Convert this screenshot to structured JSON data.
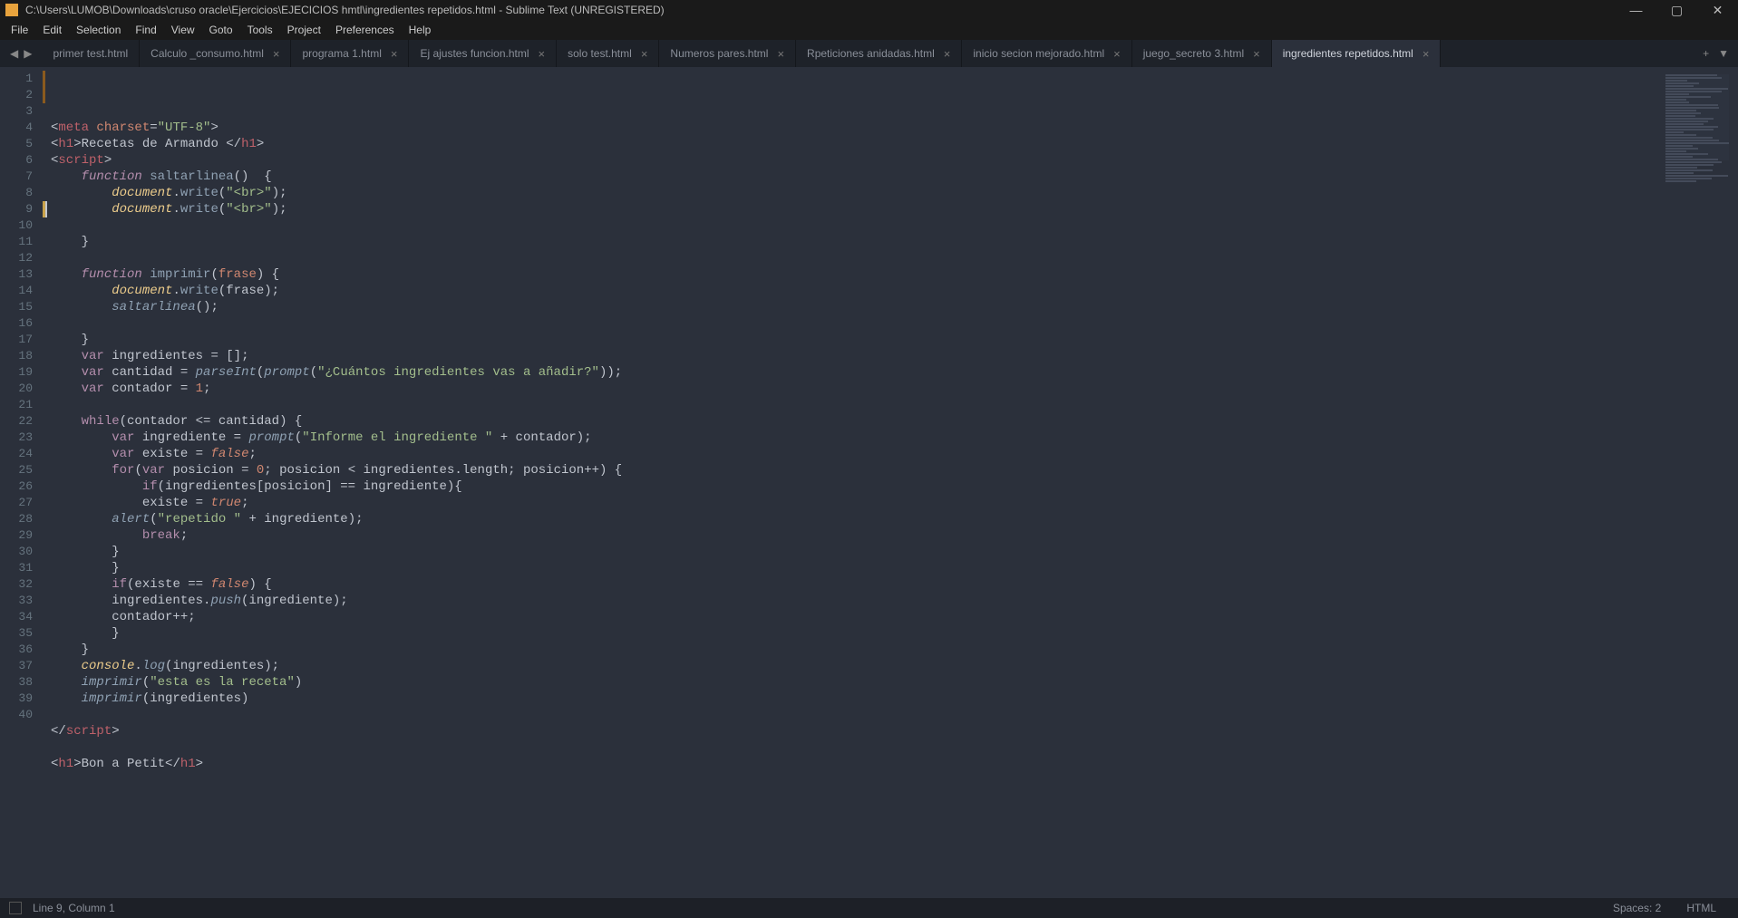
{
  "window": {
    "title": "C:\\Users\\LUMOB\\Downloads\\cruso oracle\\Ejercicios\\EJECICIOS hmtl\\ingredientes repetidos.html - Sublime Text (UNREGISTERED)"
  },
  "menu": [
    "File",
    "Edit",
    "Selection",
    "Find",
    "View",
    "Goto",
    "Tools",
    "Project",
    "Preferences",
    "Help"
  ],
  "tabs": [
    {
      "label": "primer test.html",
      "active": false,
      "closable": false
    },
    {
      "label": "Calculo _consumo.html",
      "active": false,
      "closable": true
    },
    {
      "label": "programa 1.html",
      "active": false,
      "closable": true
    },
    {
      "label": "Ej ajustes funcion.html",
      "active": false,
      "closable": true
    },
    {
      "label": "solo test.html",
      "active": false,
      "closable": true
    },
    {
      "label": "Numeros pares.html",
      "active": false,
      "closable": true
    },
    {
      "label": "Rpeticiones anidadas.html",
      "active": false,
      "closable": true
    },
    {
      "label": "inicio secion mejorado.html",
      "active": false,
      "closable": true
    },
    {
      "label": "juego_secreto 3.html",
      "active": false,
      "closable": true
    },
    {
      "label": "ingredientes repetidos.html",
      "active": true,
      "closable": true
    }
  ],
  "code_lines": [
    [
      [
        "<",
        "c-punct"
      ],
      [
        "meta",
        "c-tag"
      ],
      [
        " ",
        "c-punct"
      ],
      [
        "charset",
        "c-attr"
      ],
      [
        "=",
        "c-op"
      ],
      [
        "\"UTF-8\"",
        "c-str"
      ],
      [
        ">",
        "c-punct"
      ]
    ],
    [
      [
        "<",
        "c-punct"
      ],
      [
        "h1",
        "c-tag"
      ],
      [
        ">",
        "c-punct"
      ],
      [
        "Recetas de Armando ",
        "c-var"
      ],
      [
        "</",
        "c-punct"
      ],
      [
        "h1",
        "c-tag"
      ],
      [
        ">",
        "c-punct"
      ]
    ],
    [
      [
        "<",
        "c-punct"
      ],
      [
        "script",
        "c-tag"
      ],
      [
        ">",
        "c-punct"
      ]
    ],
    [
      [
        "    ",
        "c-var"
      ],
      [
        "function",
        "c-kwst"
      ],
      [
        " ",
        "c-var"
      ],
      [
        "saltarlinea",
        "c-fn"
      ],
      [
        "()  {",
        "c-punct"
      ]
    ],
    [
      [
        "        ",
        "c-var"
      ],
      [
        "document",
        "c-objI"
      ],
      [
        ".",
        "c-punct"
      ],
      [
        "write",
        "c-fn"
      ],
      [
        "(",
        "c-punct"
      ],
      [
        "\"<br>\"",
        "c-str"
      ],
      [
        ");",
        "c-punct"
      ]
    ],
    [
      [
        "        ",
        "c-var"
      ],
      [
        "document",
        "c-objI"
      ],
      [
        ".",
        "c-punct"
      ],
      [
        "write",
        "c-fn"
      ],
      [
        "(",
        "c-punct"
      ],
      [
        "\"<br>\"",
        "c-str"
      ],
      [
        ");",
        "c-punct"
      ]
    ],
    [],
    [
      [
        "    }",
        "c-punct"
      ]
    ],
    [],
    [
      [
        "    ",
        "c-var"
      ],
      [
        "function",
        "c-kwst"
      ],
      [
        " ",
        "c-var"
      ],
      [
        "imprimir",
        "c-fn"
      ],
      [
        "(",
        "c-punct"
      ],
      [
        "frase",
        "c-attr"
      ],
      [
        ") {",
        "c-punct"
      ]
    ],
    [
      [
        "        ",
        "c-var"
      ],
      [
        "document",
        "c-objI"
      ],
      [
        ".",
        "c-punct"
      ],
      [
        "write",
        "c-fn"
      ],
      [
        "(",
        "c-punct"
      ],
      [
        "frase",
        "c-var"
      ],
      [
        ");",
        "c-punct"
      ]
    ],
    [
      [
        "        ",
        "c-var"
      ],
      [
        "saltarlinea",
        "c-fni"
      ],
      [
        "();",
        "c-punct"
      ]
    ],
    [],
    [
      [
        "    }",
        "c-punct"
      ]
    ],
    [
      [
        "    ",
        "c-var"
      ],
      [
        "var",
        "c-kw"
      ],
      [
        " ingredientes ",
        "c-var"
      ],
      [
        "=",
        "c-op"
      ],
      [
        " [];",
        "c-punct"
      ]
    ],
    [
      [
        "    ",
        "c-var"
      ],
      [
        "var",
        "c-kw"
      ],
      [
        " cantidad ",
        "c-var"
      ],
      [
        "=",
        "c-op"
      ],
      [
        " ",
        "c-var"
      ],
      [
        "parseInt",
        "c-fni"
      ],
      [
        "(",
        "c-punct"
      ],
      [
        "prompt",
        "c-fni"
      ],
      [
        "(",
        "c-punct"
      ],
      [
        "\"¿Cuántos ingredientes vas a añadir?\"",
        "c-str"
      ],
      [
        "));",
        "c-punct"
      ]
    ],
    [
      [
        "    ",
        "c-var"
      ],
      [
        "var",
        "c-kw"
      ],
      [
        " contador ",
        "c-var"
      ],
      [
        "=",
        "c-op"
      ],
      [
        " ",
        "c-var"
      ],
      [
        "1",
        "c-num"
      ],
      [
        ";",
        "c-punct"
      ]
    ],
    [],
    [
      [
        "    ",
        "c-var"
      ],
      [
        "while",
        "c-kw"
      ],
      [
        "(contador ",
        "c-var"
      ],
      [
        "<=",
        "c-op"
      ],
      [
        " cantidad) {",
        "c-var"
      ]
    ],
    [
      [
        "        ",
        "c-var"
      ],
      [
        "var",
        "c-kw"
      ],
      [
        " ingrediente ",
        "c-var"
      ],
      [
        "=",
        "c-op"
      ],
      [
        " ",
        "c-var"
      ],
      [
        "prompt",
        "c-fni"
      ],
      [
        "(",
        "c-punct"
      ],
      [
        "\"Informe el ingrediente \"",
        "c-str"
      ],
      [
        " ",
        "c-var"
      ],
      [
        "+",
        "c-op"
      ],
      [
        " contador);",
        "c-var"
      ]
    ],
    [
      [
        "        ",
        "c-var"
      ],
      [
        "var",
        "c-kw"
      ],
      [
        " existe ",
        "c-var"
      ],
      [
        "=",
        "c-op"
      ],
      [
        " ",
        "c-var"
      ],
      [
        "false",
        "c-bool"
      ],
      [
        ";",
        "c-punct"
      ]
    ],
    [
      [
        "        ",
        "c-var"
      ],
      [
        "for",
        "c-kw"
      ],
      [
        "(",
        "c-punct"
      ],
      [
        "var",
        "c-kw"
      ],
      [
        " posicion ",
        "c-var"
      ],
      [
        "=",
        "c-op"
      ],
      [
        " ",
        "c-var"
      ],
      [
        "0",
        "c-num"
      ],
      [
        "; posicion ",
        "c-var"
      ],
      [
        "<",
        "c-op"
      ],
      [
        " ingredientes",
        "c-var"
      ],
      [
        ".",
        "c-punct"
      ],
      [
        "length",
        "c-var"
      ],
      [
        "; posicion",
        "c-var"
      ],
      [
        "++",
        "c-op"
      ],
      [
        ") {",
        "c-punct"
      ]
    ],
    [
      [
        "            ",
        "c-var"
      ],
      [
        "if",
        "c-kw"
      ],
      [
        "(ingredientes[posicion] ",
        "c-var"
      ],
      [
        "==",
        "c-op"
      ],
      [
        " ingrediente){",
        "c-var"
      ]
    ],
    [
      [
        "            existe ",
        "c-var"
      ],
      [
        "=",
        "c-op"
      ],
      [
        " ",
        "c-var"
      ],
      [
        "true",
        "c-bool"
      ],
      [
        ";",
        "c-punct"
      ]
    ],
    [
      [
        "        ",
        "c-var"
      ],
      [
        "alert",
        "c-fni"
      ],
      [
        "(",
        "c-punct"
      ],
      [
        "\"repetido \"",
        "c-str"
      ],
      [
        " ",
        "c-var"
      ],
      [
        "+",
        "c-op"
      ],
      [
        " ingrediente);",
        "c-var"
      ]
    ],
    [
      [
        "            ",
        "c-var"
      ],
      [
        "break",
        "c-kw"
      ],
      [
        ";",
        "c-punct"
      ]
    ],
    [
      [
        "        }",
        "c-punct"
      ]
    ],
    [
      [
        "        }",
        "c-punct"
      ]
    ],
    [
      [
        "        ",
        "c-var"
      ],
      [
        "if",
        "c-kw"
      ],
      [
        "(existe ",
        "c-var"
      ],
      [
        "==",
        "c-op"
      ],
      [
        " ",
        "c-var"
      ],
      [
        "false",
        "c-bool"
      ],
      [
        ") {",
        "c-punct"
      ]
    ],
    [
      [
        "        ingredientes",
        "c-var"
      ],
      [
        ".",
        "c-punct"
      ],
      [
        "push",
        "c-fni"
      ],
      [
        "(ingrediente);",
        "c-var"
      ]
    ],
    [
      [
        "        contador",
        "c-var"
      ],
      [
        "++",
        "c-op"
      ],
      [
        ";",
        "c-punct"
      ]
    ],
    [
      [
        "        }",
        "c-punct"
      ]
    ],
    [
      [
        "    }",
        "c-punct"
      ]
    ],
    [
      [
        "    ",
        "c-var"
      ],
      [
        "console",
        "c-objI"
      ],
      [
        ".",
        "c-punct"
      ],
      [
        "log",
        "c-fni"
      ],
      [
        "(ingredientes);",
        "c-var"
      ]
    ],
    [
      [
        "    ",
        "c-var"
      ],
      [
        "imprimir",
        "c-fni"
      ],
      [
        "(",
        "c-punct"
      ],
      [
        "\"esta es la receta\"",
        "c-str"
      ],
      [
        ")",
        "c-punct"
      ]
    ],
    [
      [
        "    ",
        "c-var"
      ],
      [
        "imprimir",
        "c-fni"
      ],
      [
        "(ingredientes)",
        "c-var"
      ]
    ],
    [],
    [
      [
        "</",
        "c-punct"
      ],
      [
        "script",
        "c-tag"
      ],
      [
        ">",
        "c-punct"
      ]
    ],
    [],
    [
      [
        "<",
        "c-punct"
      ],
      [
        "h1",
        "c-tag"
      ],
      [
        ">",
        "c-punct"
      ],
      [
        "Bon a Petit",
        "c-var"
      ],
      [
        "</",
        "c-punct"
      ],
      [
        "h1",
        "c-tag"
      ],
      [
        ">",
        "c-punct"
      ]
    ]
  ],
  "status": {
    "position": "Line 9, Column 1",
    "spaces": "Spaces: 2",
    "syntax": "HTML"
  }
}
